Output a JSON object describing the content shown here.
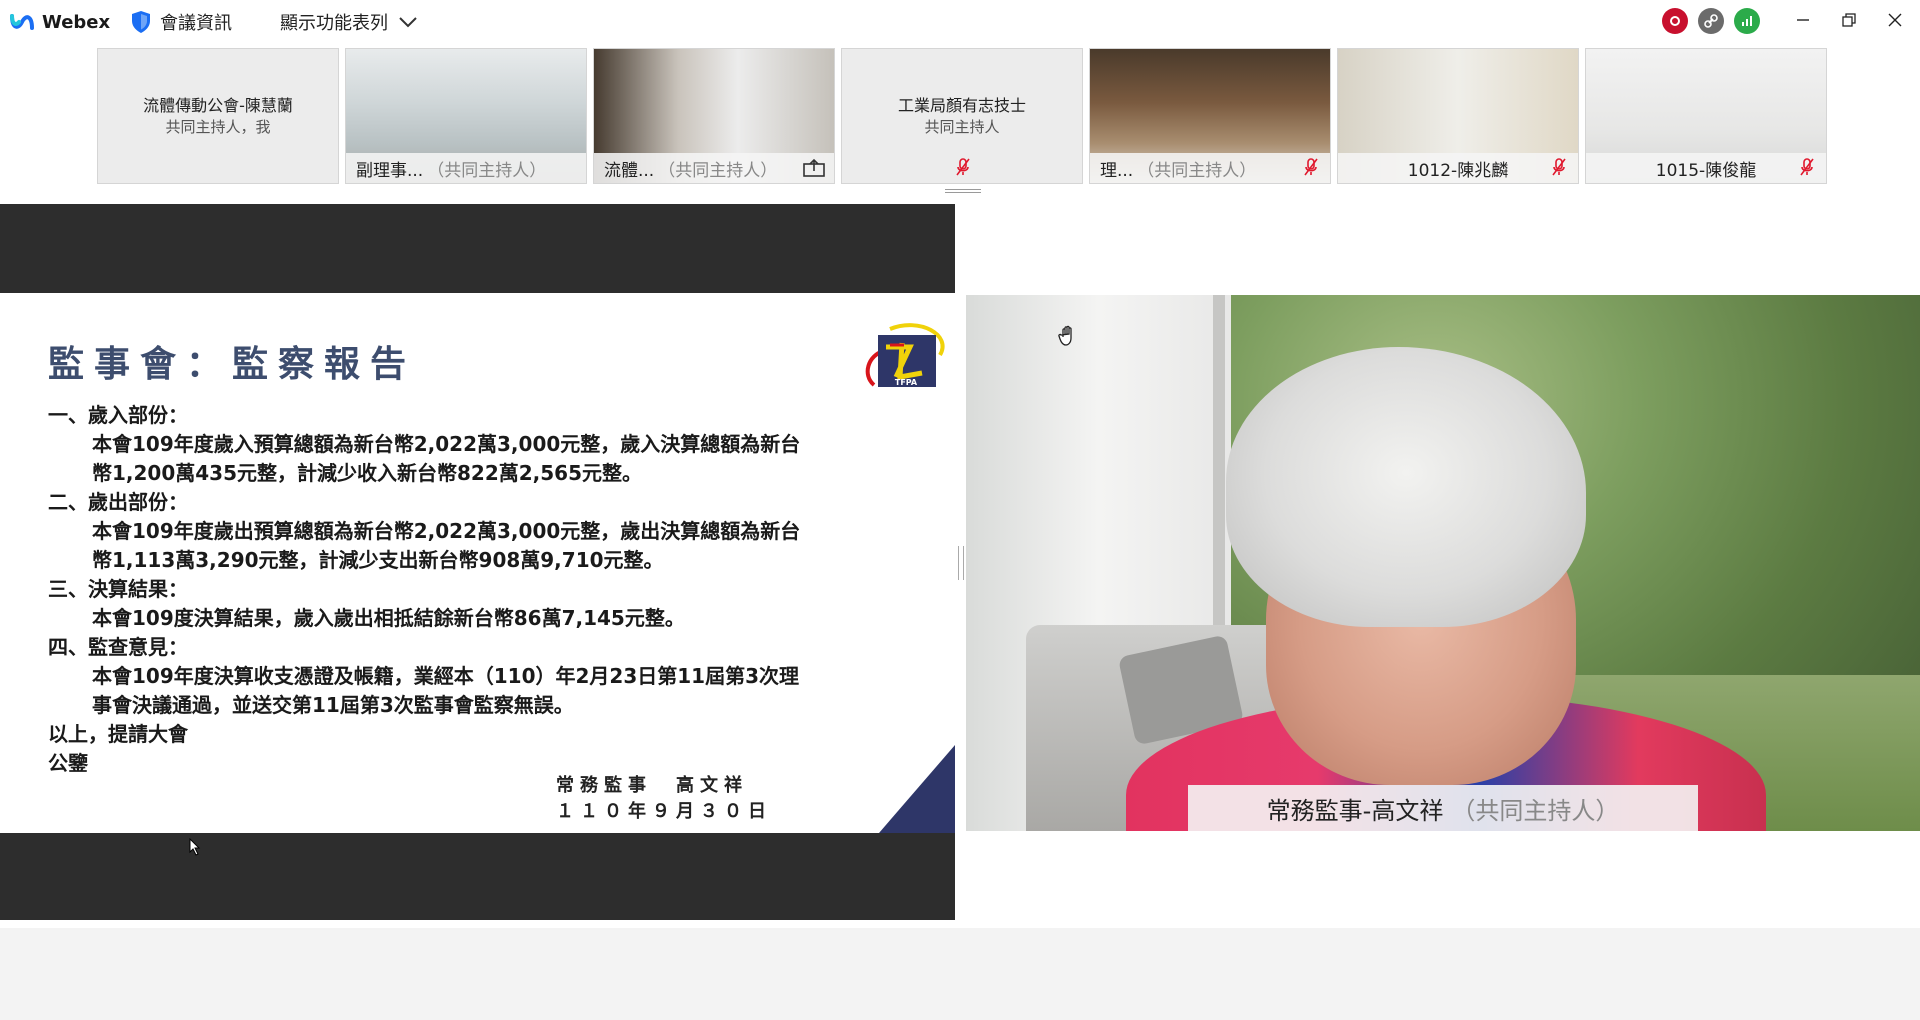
{
  "titlebar": {
    "app_name": "Webex",
    "meeting_info_label": "會議資訊",
    "view_menu_label": "顯示功能表列"
  },
  "status_icons": [
    {
      "name": "recording-icon",
      "color": "#c8102e"
    },
    {
      "name": "link-icon",
      "color": "#6b6b6b"
    },
    {
      "name": "signal-icon",
      "color": "#2bab4a"
    }
  ],
  "filmstrip": [
    {
      "name": "流體傳動公會-陳慧蘭",
      "role": "共同主持人，我",
      "video": false
    },
    {
      "name": "副理事...",
      "role": "（共同主持人）",
      "video": true
    },
    {
      "name": "流體...",
      "role": "（共同主持人）",
      "video": true
    },
    {
      "name": "工業局顏有志技士",
      "role": "共同主持人",
      "video": false
    },
    {
      "name": "理...",
      "role": "（共同主持人）",
      "video": true
    },
    {
      "name": "1012-陳兆麟",
      "role": "",
      "video": true
    },
    {
      "name": "1015-陳俊龍",
      "role": "",
      "video": true
    }
  ],
  "slide": {
    "title": "監事會：監察報告",
    "lines": [
      {
        "type": "h",
        "text": "一、歲入部份："
      },
      {
        "type": "p",
        "text": "本會109年度歲入預算總額為新台幣2,022萬3,000元整，歲入決算總額為新台"
      },
      {
        "type": "p",
        "text": "幣1,200萬435元整，計減少收入新台幣822萬2,565元整。"
      },
      {
        "type": "h",
        "text": "二、歲出部份："
      },
      {
        "type": "p",
        "text": "本會109年度歲出預算總額為新台幣2,022萬3,000元整，歲出決算總額為新台"
      },
      {
        "type": "p",
        "text": "幣1,113萬3,290元整，計減少支出新台幣908萬9,710元整。"
      },
      {
        "type": "h",
        "text": "三、決算結果："
      },
      {
        "type": "p",
        "text": "本會109度決算結果，歲入歲出相抵結餘新台幣86萬7,145元整。"
      },
      {
        "type": "h",
        "text": "四、監查意見："
      },
      {
        "type": "p",
        "text": "本會109年度決算收支憑證及帳籍，業經本（110）年2月23日第11屆第3次理"
      },
      {
        "type": "p",
        "text": "事會決議通過，並送交第11屆第3次監事會監察無誤。"
      },
      {
        "type": "h",
        "text": "以上，提請大會"
      },
      {
        "type": "h",
        "text": "公鑒"
      }
    ],
    "sign_title": "常務監事　高文祥",
    "sign_date": "１１０年９月３０日",
    "logo_text": "TFPA"
  },
  "active_speaker": {
    "name": "常務監事-高文祥",
    "role": "（共同主持人）"
  },
  "colors": {
    "slide_title": "#3d4d6e",
    "slide_corner": "#2e3668",
    "webex_blue": "#1b6ef3",
    "mute_red": "#e0182d"
  }
}
